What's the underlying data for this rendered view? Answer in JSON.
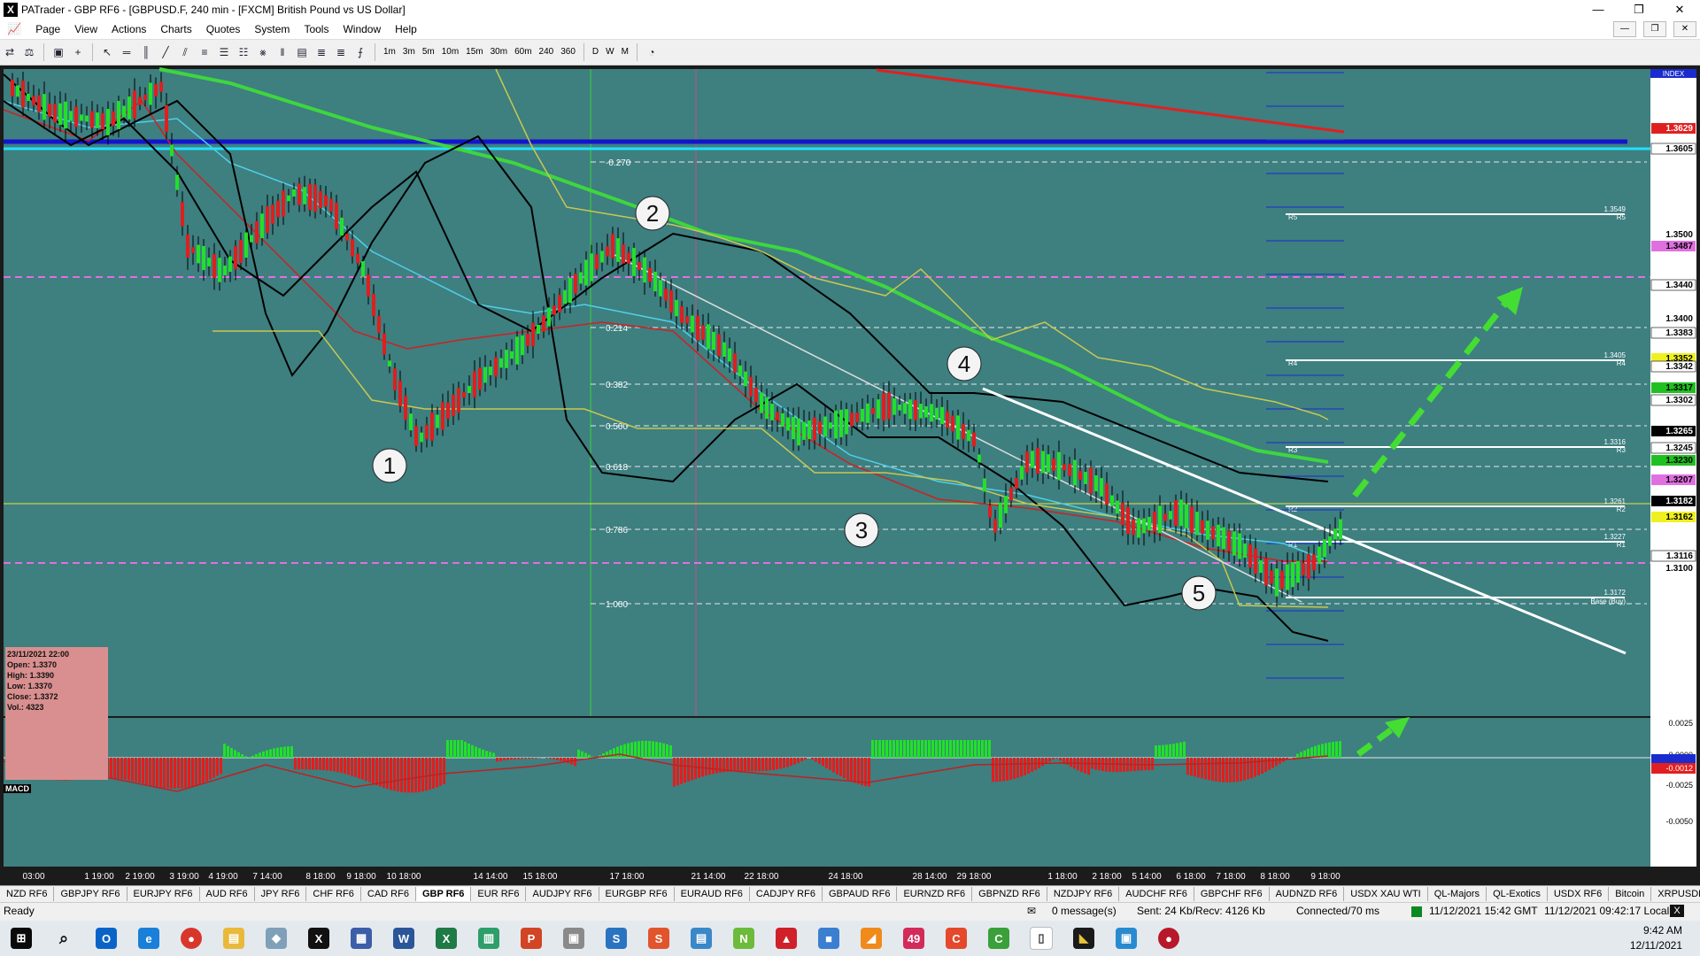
{
  "window": {
    "title": "PATrader - GBP RF6 - [GBPUSD.F, 240 min - [FXCM] British Pound vs US Dollar]",
    "controls": [
      "—",
      "❐",
      "✕"
    ]
  },
  "menu": [
    "Page",
    "View",
    "Actions",
    "Charts",
    "Quotes",
    "System",
    "Tools",
    "Window",
    "Help"
  ],
  "toolbar": {
    "timeframes": [
      "1m",
      "3m",
      "5m",
      "10m",
      "15m",
      "30m",
      "60m",
      "240",
      "360"
    ],
    "periods": [
      "D",
      "W",
      "M"
    ]
  },
  "chart": {
    "index_label": "INDEX",
    "price_labels": [
      {
        "text": "1.3629",
        "style": "red"
      },
      {
        "text": "1.3605",
        "style": "plain"
      },
      {
        "text": "1.3500",
        "style": "axis"
      },
      {
        "text": "1.3487",
        "style": "magenta"
      },
      {
        "text": "1.3440",
        "style": "plain"
      },
      {
        "text": "1.3400",
        "style": "axis"
      },
      {
        "text": "1.3383",
        "style": "plain"
      },
      {
        "text": "1.3352",
        "style": "yellow"
      },
      {
        "text": "1.3342",
        "style": "plain"
      },
      {
        "text": "1.3317",
        "style": "green"
      },
      {
        "text": "1.3302",
        "style": "plain"
      },
      {
        "text": "1.3265",
        "style": "black"
      },
      {
        "text": "1.3245",
        "style": "plain"
      },
      {
        "text": "1.3230",
        "style": "green"
      },
      {
        "text": "1.3207",
        "style": "magenta"
      },
      {
        "text": "1.3182",
        "style": "black"
      },
      {
        "text": "1.3162",
        "style": "yellow"
      },
      {
        "text": "1.3116",
        "style": "plain"
      },
      {
        "text": "1.3100",
        "style": "axis"
      }
    ],
    "macd_labels": [
      "0.0025",
      "0.0000",
      "-0.0012",
      "-0.0025",
      "-0.0050"
    ],
    "time_labels": [
      "03:00",
      "1 19:00",
      "2 19:00",
      "3 19:00",
      "4 19:00",
      "7 14:00",
      "8 18:00",
      "9 18:00",
      "10 18:00",
      "14 14:00",
      "15 18:00",
      "17 18:00",
      "21 14:00",
      "22 18:00",
      "24 18:00",
      "28 14:00",
      "29 18:00",
      "1 18:00",
      "2 18:00",
      "5 14:00",
      "6 18:00",
      "7 18:00",
      "8 18:00",
      "9 18:00"
    ],
    "fib_levels": [
      "-0.270",
      "0.214",
      "0.382",
      "0.500",
      "0.618",
      "0.786",
      "1.000"
    ],
    "pivots": [
      {
        "tag": "R5",
        "value": "1.3549"
      },
      {
        "tag": "R4",
        "value": "1.3405"
      },
      {
        "tag": "R3",
        "value": "1.3316"
      },
      {
        "tag": "R2",
        "value": "1.3261"
      },
      {
        "tag": "R1",
        "value": "1.3227"
      },
      {
        "tag": "Base (Buy)",
        "value": "1.3172"
      }
    ],
    "wave_labels": [
      "1",
      "2",
      "3",
      "4",
      "5"
    ],
    "ohlc": {
      "date": "23/11/2021 22:00",
      "open": "Open: 1.3370",
      "high": "High: 1.3390",
      "low": "Low: 1.3370",
      "close": "Close: 1.3372",
      "vol": "Vol.: 4323"
    },
    "macd_name": "MACD",
    "colors": {
      "background": "#3e7f80",
      "bull": "#22e02a",
      "bear": "#e01e1e",
      "blue_line": "#1414d0",
      "cyan_line": "#20e0ff",
      "ma_green": "#3ed63e",
      "ma_red": "#d02020",
      "magenta": "#e070e0",
      "arrow": "#44dd33"
    }
  },
  "symbol_tabs": [
    "NZD RF6",
    "GBPJPY RF6",
    "EURJPY RF6",
    "AUD RF6",
    "JPY RF6",
    "CHF RF6",
    "CAD RF6",
    "GBP RF6",
    "EUR RF6",
    "AUDJPY RF6",
    "EURGBP RF6",
    "EURAUD RF6",
    "CADJPY RF6",
    "GBPAUD RF6",
    "EURNZD RF6",
    "GBPNZD RF6",
    "NZDJPY RF6",
    "AUDCHF RF6",
    "GBPCHF RF6",
    "AUDNZD RF6",
    "USDX XAU WTI",
    "QL-Majors",
    "QL-Exotics",
    "USDX RF6",
    "Bitcoin",
    "XRPUSDRF6"
  ],
  "active_tab": "GBP RF6",
  "status": {
    "ready": "Ready",
    "messages": "0 message(s)",
    "traffic": "Sent: 24 Kb/Recv: 4126 Kb",
    "connection": "Connected/70 ms",
    "gmt": "11/12/2021 15:42 GMT",
    "local": "11/12/2021 09:42:17 Local"
  },
  "taskbar": {
    "time": "9:42 AM",
    "date": "12/11/2021"
  }
}
